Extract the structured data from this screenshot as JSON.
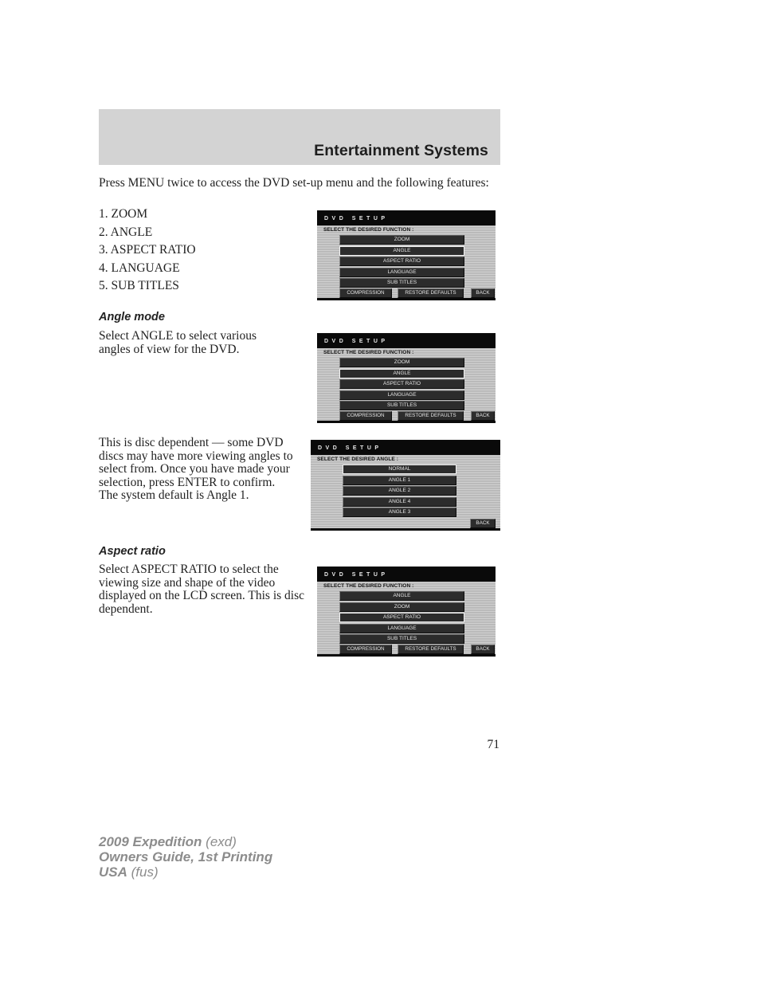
{
  "header": {
    "title": "Entertainment Systems"
  },
  "intro": "Press MENU twice to access the DVD set-up menu and the following features:",
  "features": [
    "1. ZOOM",
    "2. ANGLE",
    "3. ASPECT RATIO",
    "4. LANGUAGE",
    "5. SUB TITLES"
  ],
  "sections": {
    "angle_mode": {
      "heading": "Angle mode",
      "text": "Select ANGLE to select various angles of view for the DVD.",
      "text2": "This is disc dependent — some DVD discs may have more viewing angles to select from. Once you have made your selection, press ENTER to confirm. The system default is Angle 1."
    },
    "aspect_ratio": {
      "heading": "Aspect ratio",
      "text": "Select ASPECT RATIO to select the viewing size and shape of the video displayed on the LCD screen. This is disc dependent."
    }
  },
  "screens": [
    {
      "title": "DVD SETUP",
      "prompt": "SELECT THE DESIRED FUNCTION :",
      "items": [
        "ZOOM",
        "ANGLE",
        "ASPECT RATIO",
        "LANGUAGE",
        "SUB TITLES"
      ],
      "selected_index": 1,
      "buttons": [
        "COMPRESSION",
        "RESTORE DEFAULTS",
        "BACK"
      ]
    },
    {
      "title": "DVD SETUP",
      "prompt": "SELECT THE DESIRED FUNCTION :",
      "items": [
        "ZOOM",
        "ANGLE",
        "ASPECT RATIO",
        "LANGUAGE",
        "SUB TITLES"
      ],
      "selected_index": 1,
      "buttons": [
        "COMPRESSION",
        "RESTORE DEFAULTS",
        "BACK"
      ]
    },
    {
      "title": "DVD SETUP",
      "prompt": "SELECT THE DESIRED ANGLE :",
      "items": [
        "NORMAL",
        "ANGLE 1",
        "ANGLE 2",
        "ANGLE 4",
        "ANGLE 3"
      ],
      "selected_index": 0,
      "buttons": [
        "BACK"
      ]
    },
    {
      "title": "DVD SETUP",
      "prompt": "SELECT THE DESIRED FUNCTION :",
      "items": [
        "ANGLE",
        "ZOOM",
        "ASPECT RATIO",
        "LANGUAGE",
        "SUB TITLES"
      ],
      "selected_index": 2,
      "buttons": [
        "COMPRESSION",
        "RESTORE DEFAULTS",
        "BACK"
      ]
    }
  ],
  "page_number": "71",
  "footer": {
    "line1_bold": "2009 Expedition",
    "line1_italic": "(exd)",
    "line2_bold": "Owners Guide, 1st Printing",
    "line3_bold": "USA",
    "line3_italic": "(fus)"
  }
}
